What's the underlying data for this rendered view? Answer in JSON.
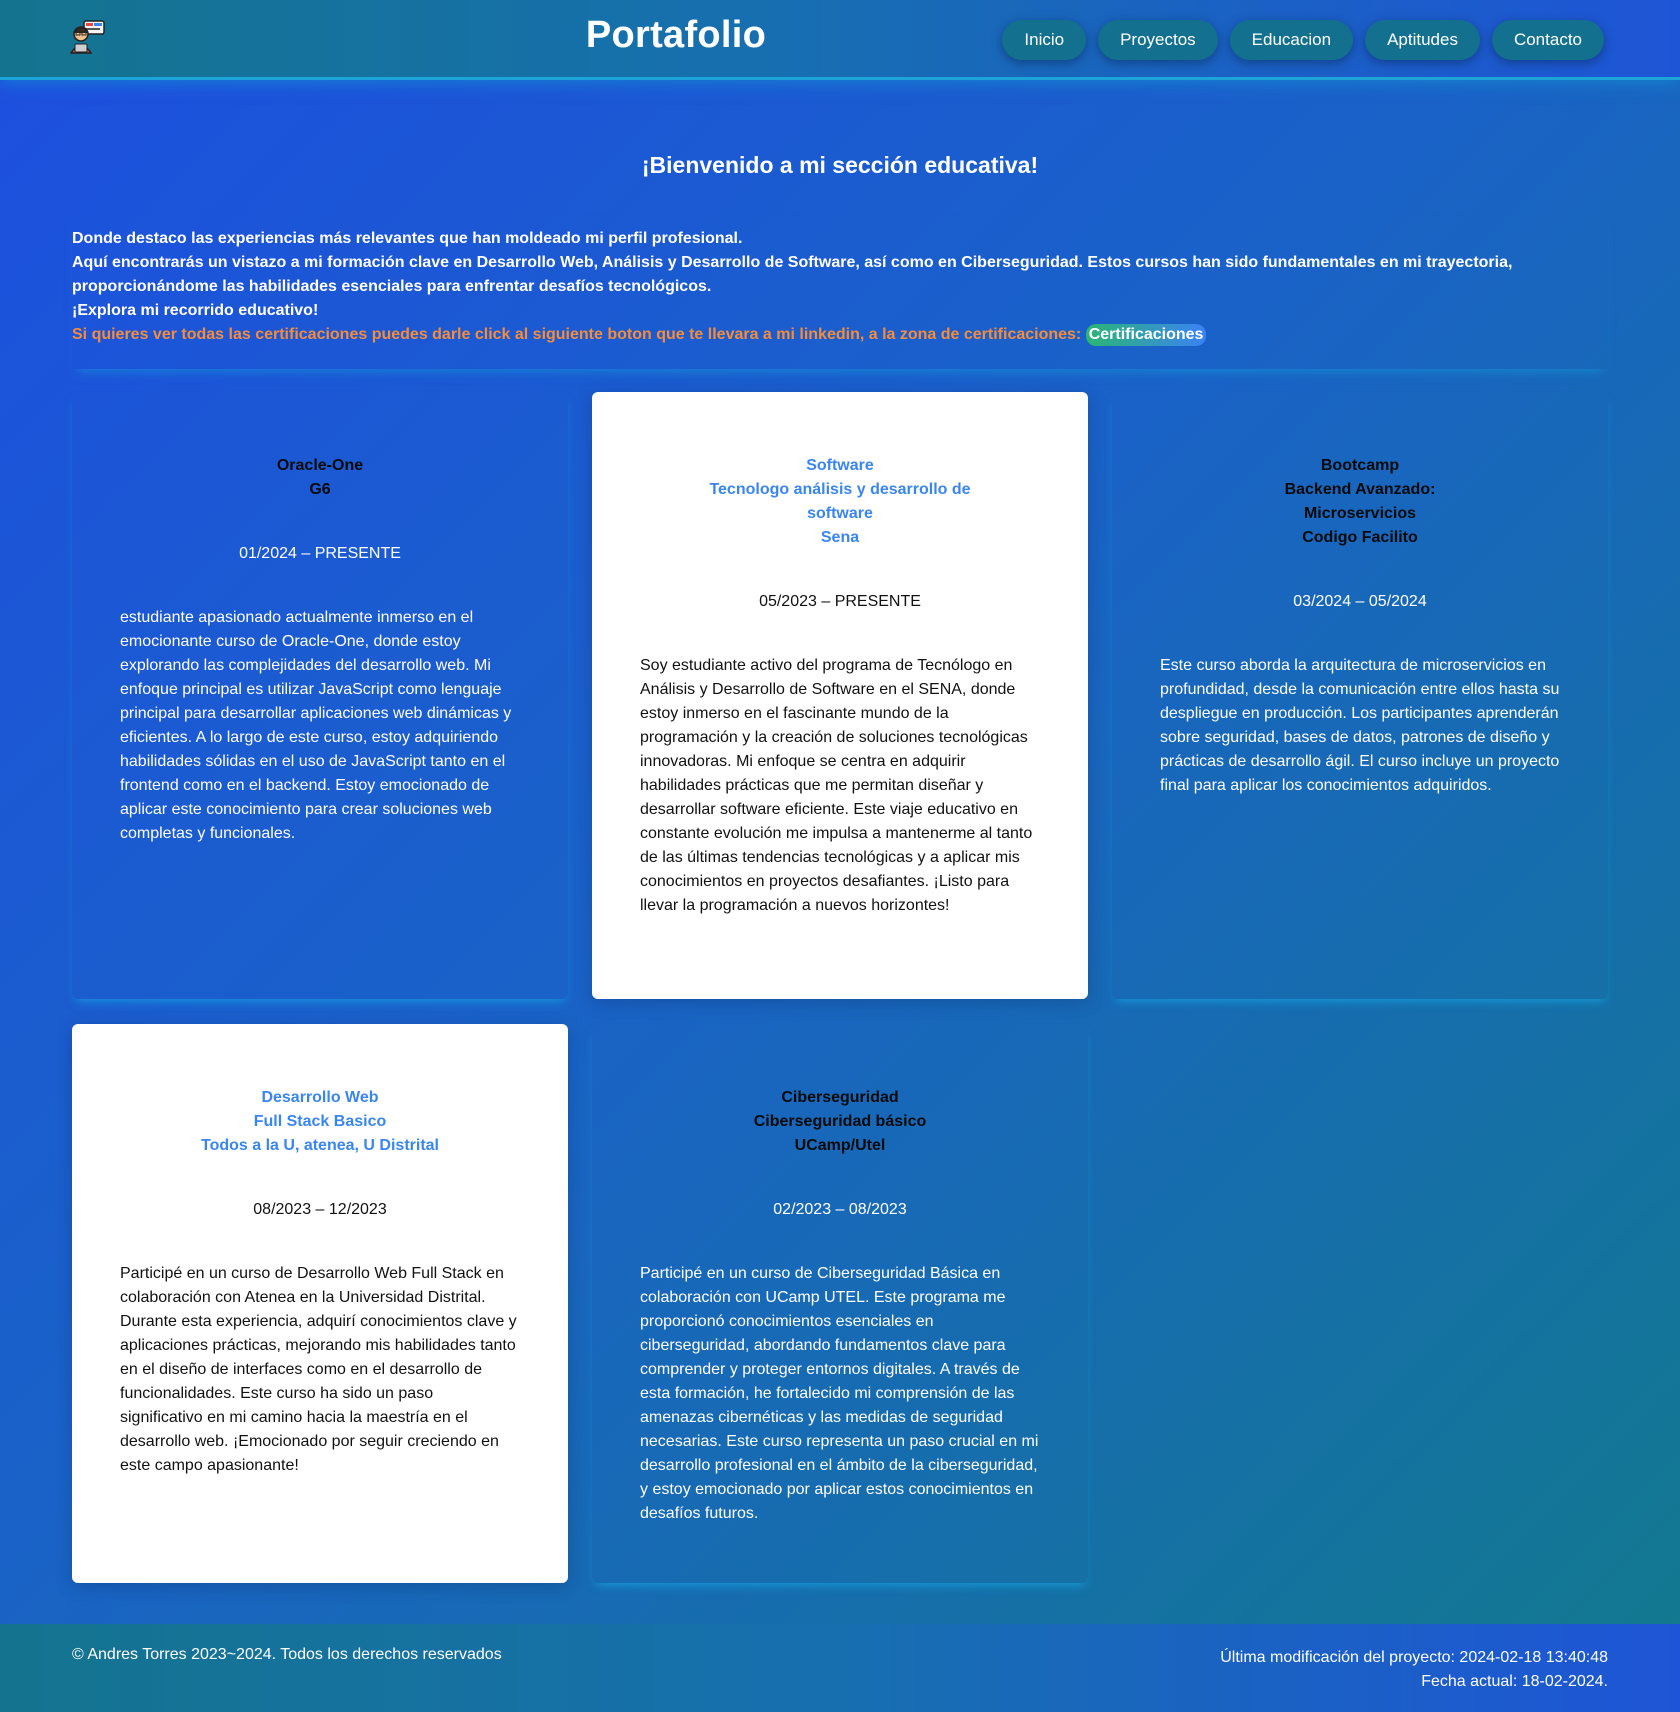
{
  "header": {
    "title": "Portafolio",
    "logo_icon": "developer-avatar-icon",
    "nav": [
      {
        "label": "Inicio"
      },
      {
        "label": "Proyectos"
      },
      {
        "label": "Educacion"
      },
      {
        "label": "Aptitudes"
      },
      {
        "label": "Contacto"
      }
    ]
  },
  "intro": {
    "welcome": "¡Bienvenido a mi sección educativa!",
    "line1": "Donde destaco las experiencias más relevantes que han moldeado mi perfil profesional.",
    "line2": "Aquí encontrarás un vistazo a mi formación clave en Desarrollo Web, Análisis y Desarrollo de Software, así como en Ciberseguridad. Estos cursos han sido fundamentales en mi trayectoria, proporcionándome las habilidades esenciales para enfrentar desafíos tecnológicos.",
    "line3": "¡Explora mi recorrido educativo!",
    "cert_text": "Si quieres ver todas las certificaciones puedes darle click al siguiente boton que te llevara a mi linkedin, a la zona de certificaciones:",
    "cert_button": "Certificaciones"
  },
  "cards": [
    {
      "title": "Oracle-One\nG6",
      "date": "01/2024 – PRESENTE",
      "description": "estudiante apasionado actualmente inmerso en el emocionante curso de Oracle-One, donde estoy explorando las complejidades del desarrollo web. Mi enfoque principal es utilizar JavaScript como lenguaje principal para desarrollar aplicaciones web dinámicas y eficientes. A lo largo de este curso, estoy adquiriendo habilidades sólidas en el uso de JavaScript tanto en el frontend como en el backend. Estoy emocionado de aplicar este conocimiento para crear soluciones web completas y funcionales."
    },
    {
      "title": "Software\nTecnologo análisis y desarrollo de software\nSena",
      "date": "05/2023 – PRESENTE",
      "description": "Soy estudiante activo del programa de Tecnólogo en Análisis y Desarrollo de Software en el SENA, donde estoy inmerso en el fascinante mundo de la programación y la creación de soluciones tecnológicas innovadoras. Mi enfoque se centra en adquirir habilidades prácticas que me permitan diseñar y desarrollar software eficiente. Este viaje educativo en constante evolución me impulsa a mantenerme al tanto de las últimas tendencias tecnológicas y a aplicar mis conocimientos en proyectos desafiantes. ¡Listo para llevar la programación a nuevos horizontes!"
    },
    {
      "title": "Bootcamp\nBackend Avanzado:\nMicroservicios\nCodigo Facilito",
      "date": "03/2024 – 05/2024",
      "description": "Este curso aborda la arquitectura de microservicios en profundidad, desde la comunicación entre ellos hasta su despliegue en producción. Los participantes aprenderán sobre seguridad, bases de datos, patrones de diseño y prácticas de desarrollo ágil. El curso incluye un proyecto final para aplicar los conocimientos adquiridos."
    },
    {
      "title": "Desarrollo Web\nFull Stack Basico\nTodos a la U, atenea, U Distrital",
      "date": "08/2023 – 12/2023",
      "description": "Participé en un curso de Desarrollo Web Full Stack en colaboración con Atenea en la Universidad Distrital. Durante esta experiencia, adquirí conocimientos clave y aplicaciones prácticas, mejorando mis habilidades tanto en el diseño de interfaces como en el desarrollo de funcionalidades. Este curso ha sido un paso significativo en mi camino hacia la maestría en el desarrollo web. ¡Emocionado por seguir creciendo en este campo apasionante!"
    },
    {
      "title": "Ciberseguridad\nCiberseguridad básico\nUCamp/Utel",
      "date": "02/2023 – 08/2023",
      "description": "Participé en un curso de Ciberseguridad Básica en colaboración con UCamp UTEL. Este programa me proporcionó conocimientos esenciales en ciberseguridad, abordando fundamentos clave para comprender y proteger entornos digitales. A través de esta formación, he fortalecido mi comprensión de las amenazas cibernéticas y las medidas de seguridad necesarias. Este curso representa un paso crucial en mi desarrollo profesional en el ámbito de la ciberseguridad, y estoy emocionado por aplicar estos conocimientos en desafíos futuros."
    }
  ],
  "footer": {
    "copyright": "© Andres Torres 2023~2024. Todos los derechos reservados",
    "last_modified": "Última modificación del proyecto: 2024-02-18 13:40:48",
    "current_date": "Fecha actual: 18-02-2024."
  },
  "colors": {
    "accent_orange": "#f48c3c",
    "card_title_blue": "#3a86f0",
    "nav_button": "#13708f"
  }
}
